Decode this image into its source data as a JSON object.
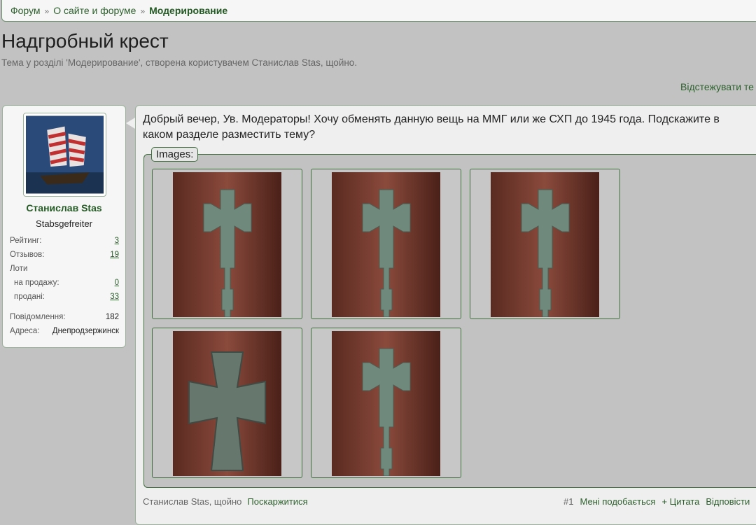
{
  "breadcrumb": [
    {
      "label": "Форум"
    },
    {
      "label": "О сайте и форуме"
    },
    {
      "label": "Модерирование"
    }
  ],
  "breadcrumb_sep": "»",
  "title": "Надгробный крест",
  "subtitle": "Тема у розділі 'Модерирование', створена користувачем Станислав Stas, щойно.",
  "watch_label": "Відстежувати те",
  "user": {
    "name": "Станислав Stas",
    "rank": "Stabsgefreiter",
    "stats": [
      {
        "label": "Рейтинг:",
        "value": "3"
      },
      {
        "label": "Отзывов:",
        "value": "19"
      },
      {
        "label": "Лоти",
        "value": ""
      },
      {
        "label": "на продажу:",
        "value": "0"
      },
      {
        "label": "продані:",
        "value": "33"
      },
      {
        "label": "Повідомлення:",
        "value": "182"
      },
      {
        "label": "Адреса:",
        "value": "Днепродзержинск"
      }
    ]
  },
  "post": {
    "message": "Добрый вечер, Ув. Модераторы! Хочу обменять данную вещь на ММГ или же СХП до 1945 года. Подскажите в каком разделе разместить тему?",
    "images_label": "Images:",
    "author_time": "Станислав Stas, щойно",
    "report": "Поскаржитися",
    "number": "#1",
    "like": "Мені подобається",
    "quote": "+ Цитата",
    "reply": "Відповісти"
  },
  "colors": {
    "accent": "#2d5f2d",
    "background": "#c2c2c2"
  }
}
